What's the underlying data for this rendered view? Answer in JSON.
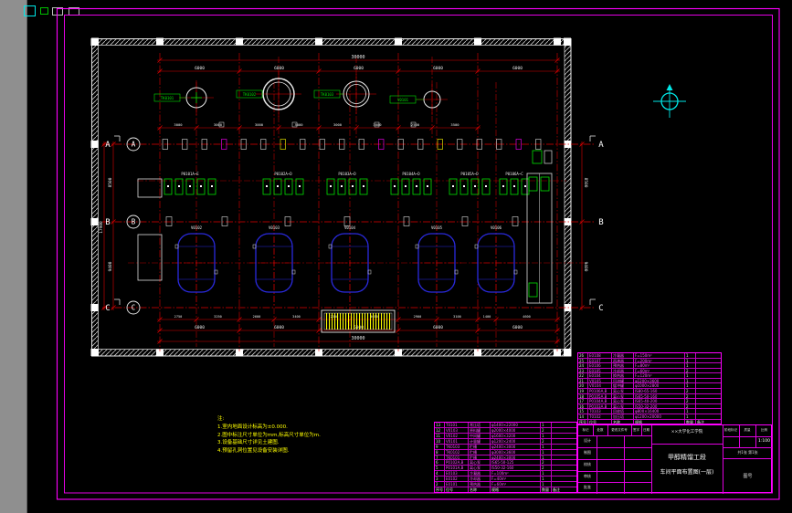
{
  "palette": {
    "frame": "#ff00ff",
    "white": "#e8e8e8",
    "red": "#e00000",
    "green": "#00e000",
    "blue": "#2a2ade",
    "yellow": "#ffff00",
    "cyan": "#00e8e8",
    "magenta": "#ff55ff"
  },
  "window": {
    "icon_names": [
      "window-layer-icon",
      "window-snap-icon",
      "window-grid-icon",
      "window-osnap-icon"
    ]
  },
  "drawing": {
    "axis_rows": [
      "A",
      "B",
      "C"
    ],
    "dims": {
      "overall_top": "30000",
      "top_chain": [
        "6000",
        "6000",
        "6000",
        "6000",
        "6000"
      ],
      "mid_chain": [
        "3000",
        "3000",
        "3000",
        "3000",
        "3000",
        "3000",
        "2500",
        "3500"
      ],
      "inner_chain": [
        "2750",
        "3250",
        "2600",
        "3400",
        "2350",
        "3650",
        "2900",
        "3100",
        "1400",
        "4600"
      ],
      "bottom_chain": [
        "6000",
        "6000",
        "6000",
        "6000",
        "6000"
      ],
      "overall_bottom": "30000",
      "left_spans": [
        "8500",
        "9400"
      ],
      "left_overall": "17900",
      "right_spans": [
        "8500",
        "9400"
      ]
    },
    "circle_tags": [
      "TK0101",
      "TK0102",
      "TK0103",
      "V0101"
    ],
    "pump_tags": [
      "P0101A~E",
      "P0102A~D",
      "P0103A~D",
      "P0104A~D",
      "P0105A~D",
      "P0106A~C"
    ],
    "vessel_tags": [
      "V0102",
      "V0103",
      "V0104",
      "V0105",
      "V0106"
    ]
  },
  "notes": {
    "title": "注:",
    "lines": [
      "1.室内地面设计标高为±0.000.",
      "2.图中标注尺寸单位为mm,标高尺寸单位为m.",
      "3.设备基础尺寸详见土建图.",
      "4.预留孔洞位置见设备安装详图."
    ]
  },
  "bom_headers": [
    "序号",
    "位号",
    "名称",
    "规格",
    "数量",
    "备注"
  ],
  "bom_right": {
    "rows": [
      [
        "26",
        "E0108",
        "冷凝器",
        "F=150m²",
        "1",
        ""
      ],
      [
        "25",
        "E0107",
        "再沸器",
        "F=200m²",
        "1",
        ""
      ],
      [
        "24",
        "E0106",
        "预热器",
        "F=80m²",
        "1",
        ""
      ],
      [
        "23",
        "E0105",
        "冷却器",
        "F=60m²",
        "2",
        ""
      ],
      [
        "22",
        "E0104",
        "换热器",
        "F=120m²",
        "1",
        ""
      ],
      [
        "21",
        "V0105",
        "回流罐",
        "φ1200×3600",
        "1",
        ""
      ],
      [
        "20",
        "V0104",
        "缓冲罐",
        "φ1000×2800",
        "1",
        ""
      ],
      [
        "19",
        "P0106A,B",
        "离心泵",
        "IS80-65-160",
        "2",
        ""
      ],
      [
        "18",
        "P0105A,B",
        "离心泵",
        "IS65-50-160",
        "2",
        ""
      ],
      [
        "17",
        "P0104A,B",
        "离心泵",
        "IS65-40-200",
        "2",
        ""
      ],
      [
        "16",
        "P0103A,B",
        "离心泵",
        "IS50-32-200",
        "2",
        ""
      ],
      [
        "15",
        "T0103",
        "回收塔",
        "φ800×16400",
        "1",
        ""
      ],
      [
        "14",
        "T0102",
        "加压塔",
        "φ1200×20000",
        "1",
        ""
      ]
    ]
  },
  "bom_bottom": {
    "rows": [
      [
        "13",
        "T0101",
        "常压塔",
        "φ1400×22000",
        "1",
        ""
      ],
      [
        "12",
        "V0103",
        "原料罐",
        "φ2000×4000",
        "2",
        ""
      ],
      [
        "11",
        "V0102",
        "中间罐",
        "φ1600×3200",
        "1",
        ""
      ],
      [
        "10",
        "V0101",
        "计量罐",
        "φ1200×2400",
        "2",
        ""
      ],
      [
        "9",
        "TK0103",
        "贮槽",
        "φ2400×3000",
        "1",
        ""
      ],
      [
        "8",
        "TK0102",
        "贮槽",
        "φ3000×3600",
        "1",
        ""
      ],
      [
        "7",
        "TK0101",
        "贮槽",
        "φ2400×3000",
        "1",
        ""
      ],
      [
        "6",
        "P0102A,B",
        "离心泵",
        "IS65-50-125",
        "2",
        ""
      ],
      [
        "5",
        "P0101A,B",
        "离心泵",
        "IS50-32-160",
        "2",
        ""
      ],
      [
        "4",
        "E0103",
        "冷凝器",
        "F=100m²",
        "1",
        ""
      ],
      [
        "3",
        "E0102",
        "冷却器",
        "F=40m²",
        "1",
        ""
      ],
      [
        "2",
        "E0101",
        "预热器",
        "F=60m²",
        "1",
        ""
      ]
    ]
  },
  "title_block": {
    "rev_headers": [
      "标记",
      "处数",
      "更改文件号",
      "签字",
      "日期"
    ],
    "role_labels": [
      "设计",
      "制图",
      "校核",
      "审核",
      "批准"
    ],
    "company": "××大学化工学院",
    "title_line1": "甲醇精馏工段",
    "title_line2": "车间平面布置图(一层)",
    "right_top": [
      "阶段标记",
      "质量",
      "比例"
    ],
    "scale": "1:100",
    "sheet": "共1张 第1张",
    "drawing_no_label": "图号"
  }
}
